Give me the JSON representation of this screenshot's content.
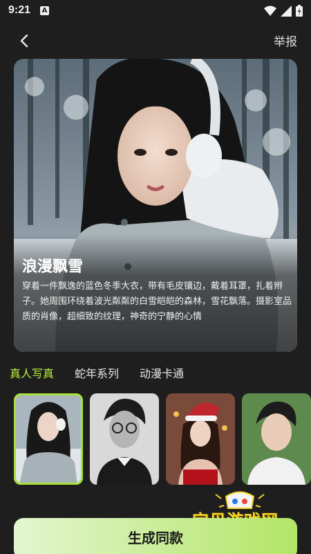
{
  "status": {
    "time": "9:21"
  },
  "nav": {
    "report_label": "举报"
  },
  "hero": {
    "title": "浪漫飘雪",
    "description": "穿着一件飘逸的蓝色冬季大衣，带有毛皮镶边，戴着耳罩，扎着辫子。她周围环绕着波光粼粼的白雪皑皑的森林，雪花飘落。摄影室品质的肖像，超细致的纹理，神奇的宁静的心情"
  },
  "tabs": [
    {
      "label": "真人写真",
      "active": true
    },
    {
      "label": "蛇年系列",
      "active": false
    },
    {
      "label": "动漫卡通",
      "active": false
    }
  ],
  "generate_label": "生成同款",
  "watermark": {
    "text": "宝贝游戏网",
    "url": "baobeiy.com"
  },
  "colors": {
    "accent": "#b9f03c",
    "background": "#1e1e1e",
    "button_start": "#e2f6cf",
    "button_end": "#b3e567"
  }
}
